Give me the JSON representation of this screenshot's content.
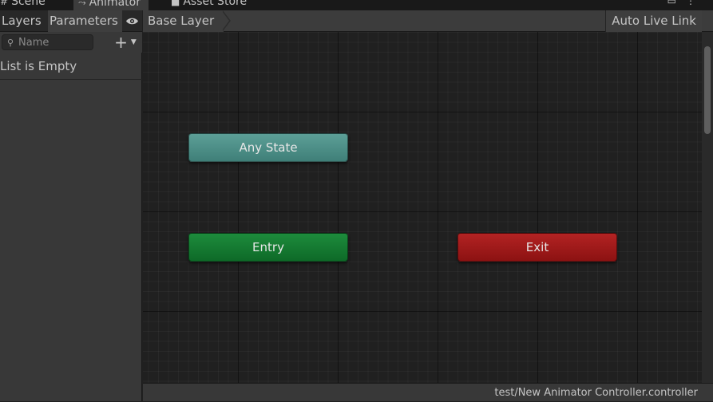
{
  "window_tabs": [
    {
      "label": "Scene",
      "icon": "grid-icon"
    },
    {
      "label": "Animator",
      "icon": "animator-icon"
    },
    {
      "label": "Asset Store",
      "icon": "asset-store-icon"
    }
  ],
  "left_panel": {
    "tabs": [
      "Layers",
      "Parameters"
    ],
    "search_placeholder": "Name",
    "empty_text": "List is Empty"
  },
  "graph": {
    "breadcrumb": "Base Layer",
    "live_link_label": "Auto Live Link",
    "nodes": {
      "any_state": "Any State",
      "entry": "Entry",
      "exit": "Exit"
    }
  },
  "status_path": "test/New Animator Controller.controller",
  "colors": {
    "any_state": "#4f8f88",
    "entry": "#157a32",
    "exit": "#a01b1b",
    "active_tab_accent": "#3a79bb"
  }
}
